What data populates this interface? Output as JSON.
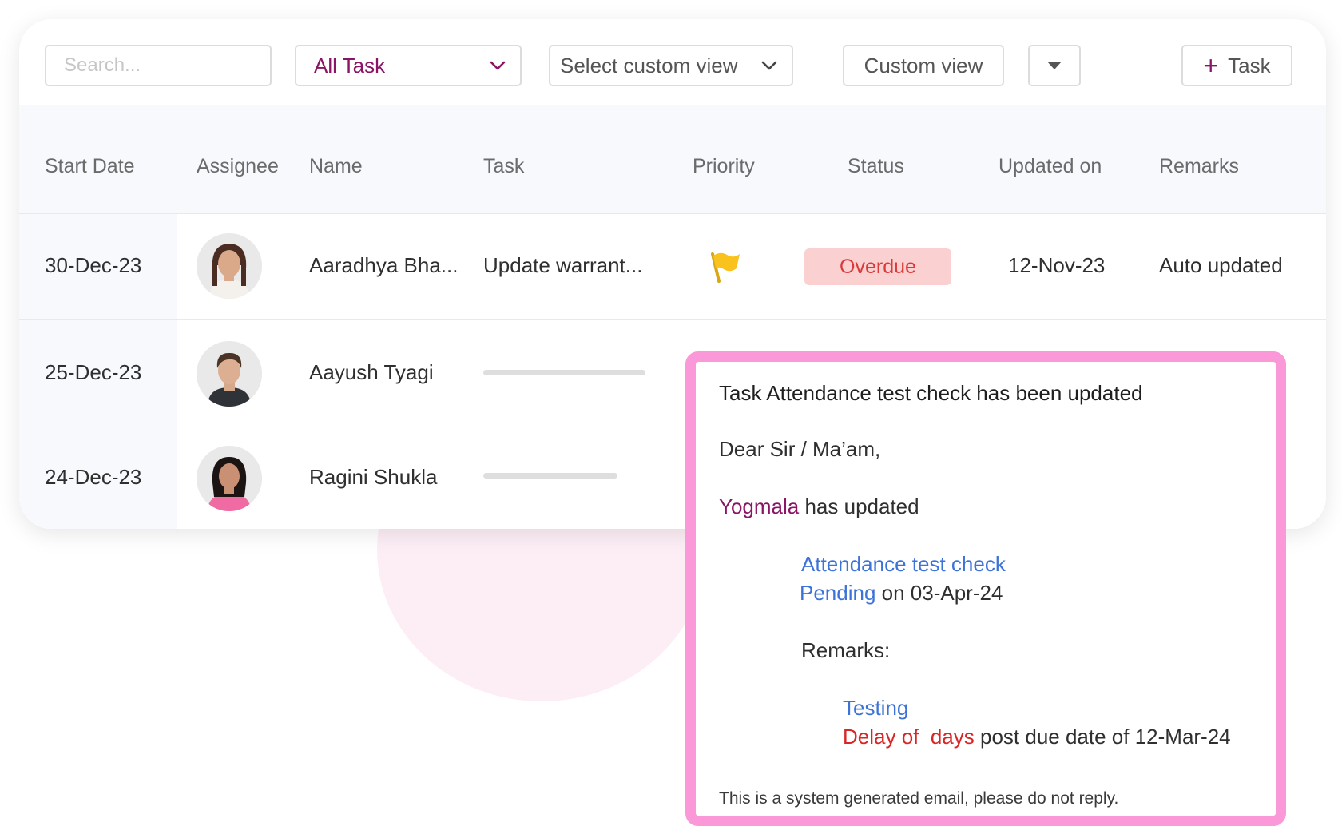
{
  "toolbar": {
    "search_placeholder": "Search...",
    "filter_selected": "All Task",
    "custom_view_select": "Select custom view",
    "custom_view_button": "Custom view",
    "add_task_label": "Task"
  },
  "table": {
    "columns": [
      "Start Date",
      "Assignee",
      "Name",
      "Task",
      "Priority",
      "Status",
      "Updated on",
      "Remarks"
    ],
    "rows": [
      {
        "start_date": "30-Dec-23",
        "name": "Aaradhya Bha...",
        "task": "Update warrant...",
        "priority": "flag-icon",
        "status": "Overdue",
        "updated_on": "12-Nov-23",
        "remarks": "Auto updated"
      },
      {
        "start_date": "25-Dec-23",
        "name": "Aayush Tyagi",
        "task_progress": 0.55
      },
      {
        "start_date": "24-Dec-23",
        "name": "Ragini Shukla",
        "task_progress": 0.45
      }
    ]
  },
  "email": {
    "subject": "Task Attendance test check has been updated",
    "greeting": "Dear Sir / Ma’am,",
    "updater": "Yogmala",
    "updated_text": "has updated",
    "task_name": "Attendance test check",
    "status": "Pending",
    "status_date": "on 03-Apr-24",
    "remarks_label": "Remarks:",
    "remarks_value": "Testing",
    "delay_part1": "Delay of",
    "delay_part2": "days",
    "delay_suffix": "post due date of 12-Mar-24",
    "footer": "This is a system generated email, please do not reply."
  },
  "colors": {
    "accent": "#8a1566",
    "link": "#3d73d8",
    "overdue_bg": "#fbd0d0",
    "overdue_text": "#d93b3b",
    "email_border": "#fb98d7",
    "delay": "#d92525"
  }
}
